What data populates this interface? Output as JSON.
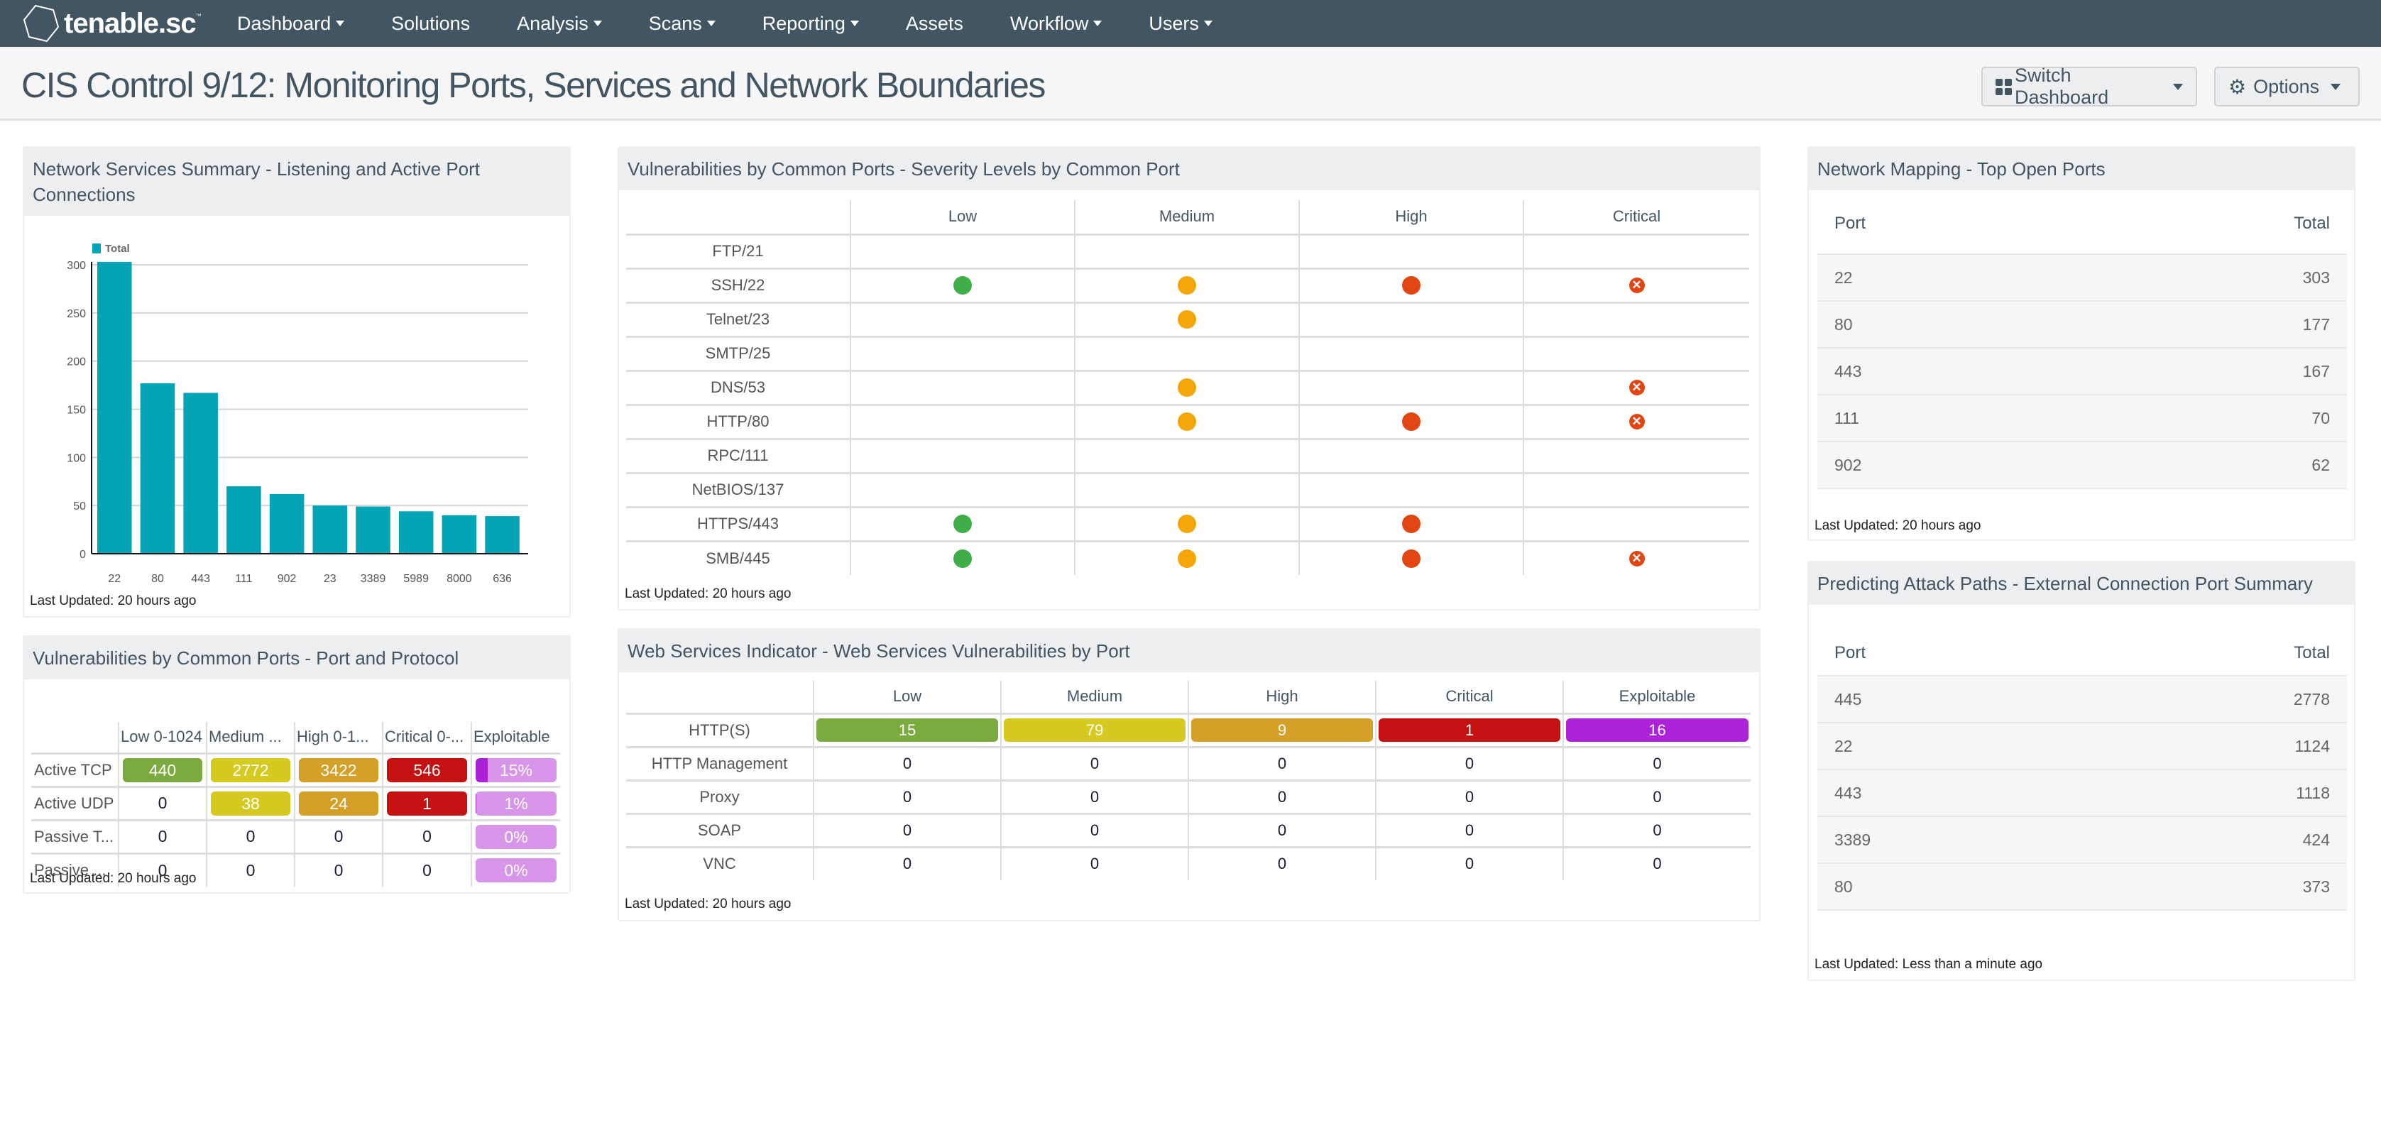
{
  "nav": {
    "logo": "tenable.sc",
    "items": [
      {
        "label": "Dashboard",
        "dropdown": true
      },
      {
        "label": "Solutions",
        "dropdown": false
      },
      {
        "label": "Analysis",
        "dropdown": true
      },
      {
        "label": "Scans",
        "dropdown": true
      },
      {
        "label": "Reporting",
        "dropdown": true
      },
      {
        "label": "Assets",
        "dropdown": false
      },
      {
        "label": "Workflow",
        "dropdown": true
      },
      {
        "label": "Users",
        "dropdown": true
      }
    ]
  },
  "titlebar": {
    "title": "CIS Control 9/12: Monitoring Ports, Services and Network Boundaries",
    "switch_dashboard": "Switch Dashboard",
    "options": "Options"
  },
  "colors": {
    "nav_bg": "#425563",
    "bar": "#02a4b6",
    "low": "#7bab3f",
    "medium": "#d6c91f",
    "high": "#d4a028",
    "critical": "#c41212",
    "exploitable": "#ad22d9",
    "dot_low": "#3fae49",
    "dot_medium": "#f5a70a",
    "dot_high": "#e14612",
    "dot_critical": "#e14612"
  },
  "panels": {
    "network_services": {
      "title": "Network Services Summary - Listening and Active Port Connections",
      "last_updated": "Last Updated: 20 hours ago"
    },
    "port_protocol": {
      "title": "Vulnerabilities by Common Ports - Port and Protocol",
      "columns": [
        "Low 0-1024",
        "Medium ...",
        "High 0-1...",
        "Critical 0-...",
        "Exploitable"
      ],
      "rows": [
        {
          "label": "Active TCP",
          "low": "440",
          "medium": "2772",
          "high": "3422",
          "critical": "546",
          "exploitable": "15%",
          "exploitable_pct": 15
        },
        {
          "label": "Active UDP",
          "low": "0",
          "medium": "38",
          "high": "24",
          "critical": "1",
          "exploitable": "1%",
          "exploitable_pct": 1
        },
        {
          "label": "Passive T...",
          "low": "0",
          "medium": "0",
          "high": "0",
          "critical": "0",
          "exploitable": "0%",
          "exploitable_pct": 0
        },
        {
          "label": "Passive ...",
          "low": "0",
          "medium": "0",
          "high": "0",
          "critical": "0",
          "exploitable": "0%",
          "exploitable_pct": 0
        }
      ],
      "last_updated": "Last Updated: 20 hours ago"
    },
    "severity_by_port": {
      "title": "Vulnerabilities by Common Ports - Severity Levels by Common Port",
      "columns": [
        "Low",
        "Medium",
        "High",
        "Critical"
      ],
      "rows": [
        {
          "label": "FTP/21",
          "low": false,
          "medium": false,
          "high": false,
          "critical": false
        },
        {
          "label": "SSH/22",
          "low": true,
          "medium": true,
          "high": true,
          "critical": true
        },
        {
          "label": "Telnet/23",
          "low": false,
          "medium": true,
          "high": false,
          "critical": false
        },
        {
          "label": "SMTP/25",
          "low": false,
          "medium": false,
          "high": false,
          "critical": false
        },
        {
          "label": "DNS/53",
          "low": false,
          "medium": true,
          "high": false,
          "critical": true
        },
        {
          "label": "HTTP/80",
          "low": false,
          "medium": true,
          "high": true,
          "critical": true
        },
        {
          "label": "RPC/111",
          "low": false,
          "medium": false,
          "high": false,
          "critical": false
        },
        {
          "label": "NetBIOS/137",
          "low": false,
          "medium": false,
          "high": false,
          "critical": false
        },
        {
          "label": "HTTPS/443",
          "low": true,
          "medium": true,
          "high": true,
          "critical": false
        },
        {
          "label": "SMB/445",
          "low": true,
          "medium": true,
          "high": true,
          "critical": true
        }
      ],
      "last_updated": "Last Updated: 20 hours ago"
    },
    "web_services": {
      "title": "Web Services Indicator - Web Services Vulnerabilities by Port",
      "columns": [
        "Low",
        "Medium",
        "High",
        "Critical",
        "Exploitable"
      ],
      "rows": [
        {
          "label": "HTTP(S)",
          "values": [
            "15",
            "79",
            "9",
            "1",
            "16"
          ]
        },
        {
          "label": "HTTP Management",
          "values": [
            "0",
            "0",
            "0",
            "0",
            "0"
          ]
        },
        {
          "label": "Proxy",
          "values": [
            "0",
            "0",
            "0",
            "0",
            "0"
          ]
        },
        {
          "label": "SOAP",
          "values": [
            "0",
            "0",
            "0",
            "0",
            "0"
          ]
        },
        {
          "label": "VNC",
          "values": [
            "0",
            "0",
            "0",
            "0",
            "0"
          ]
        }
      ],
      "last_updated": "Last Updated: 20 hours ago"
    },
    "top_open_ports": {
      "title": "Network Mapping - Top Open Ports",
      "col_port": "Port",
      "col_total": "Total",
      "rows": [
        {
          "port": "22",
          "total": "303"
        },
        {
          "port": "80",
          "total": "177"
        },
        {
          "port": "443",
          "total": "167"
        },
        {
          "port": "111",
          "total": "70"
        },
        {
          "port": "902",
          "total": "62"
        }
      ],
      "last_updated": "Last Updated: 20 hours ago"
    },
    "attack_paths": {
      "title": "Predicting Attack Paths - External Connection Port Summary",
      "col_port": "Port",
      "col_total": "Total",
      "rows": [
        {
          "port": "445",
          "total": "2778"
        },
        {
          "port": "22",
          "total": "1124"
        },
        {
          "port": "443",
          "total": "1118"
        },
        {
          "port": "3389",
          "total": "424"
        },
        {
          "port": "80",
          "total": "373"
        }
      ],
      "last_updated": "Last Updated: Less than a minute ago"
    }
  },
  "chart_data": {
    "type": "bar",
    "title": "Network Services Summary - Listening and Active Port Connections",
    "legend": [
      "Total"
    ],
    "legend_position": "top-left",
    "categories": [
      "22",
      "80",
      "443",
      "111",
      "902",
      "23",
      "3389",
      "5989",
      "8000",
      "636"
    ],
    "series": [
      {
        "name": "Total",
        "values": [
          303,
          177,
          167,
          70,
          62,
          50,
          49,
          44,
          40,
          39
        ]
      }
    ],
    "xlabel": "",
    "ylabel": "",
    "ylim": [
      0,
      300
    ],
    "yticks": [
      0,
      50,
      100,
      150,
      200,
      250,
      300
    ],
    "grid": true
  }
}
